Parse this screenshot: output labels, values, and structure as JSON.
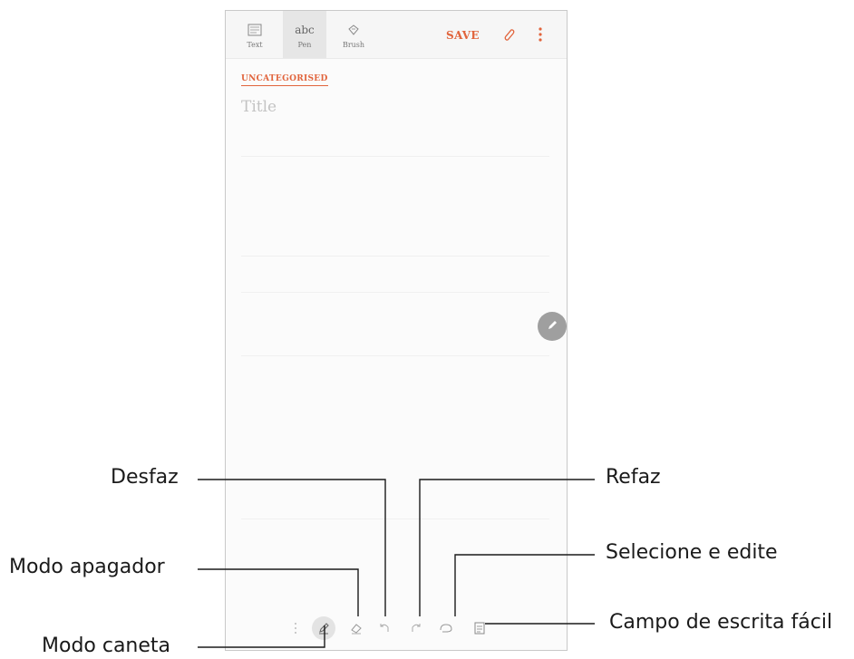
{
  "toolbar": {
    "modes": [
      {
        "label": "Text",
        "icon": "keyboard-icon"
      },
      {
        "label": "Pen",
        "icon": "abc-handwriting-icon",
        "glyph": "abc",
        "active": true
      },
      {
        "label": "Brush",
        "icon": "brush-icon"
      }
    ],
    "save_label": "SAVE",
    "attach_icon": "paperclip-icon",
    "more_icon": "more-vert-icon"
  },
  "note": {
    "category": "UNCATEGORISED",
    "title_placeholder": "Title"
  },
  "floating_button": {
    "icon": "pencil-icon"
  },
  "pen_toolbar": {
    "tools": [
      "drag-handle-icon",
      "pen-mode-icon",
      "eraser-icon",
      "undo-icon",
      "redo-icon",
      "lasso-select-icon",
      "easy-writing-pad-icon"
    ]
  },
  "callouts": {
    "undo": "Desfaz",
    "redo": "Refaz",
    "eraser": "Modo apagador",
    "select": "Selecione e edite",
    "easy_writing": "Campo de escrita fácil",
    "pen": "Modo caneta"
  },
  "colors": {
    "accent": "#e1643c",
    "placeholder": "#c3c3c3",
    "floating_button": "#9f9f9f"
  }
}
